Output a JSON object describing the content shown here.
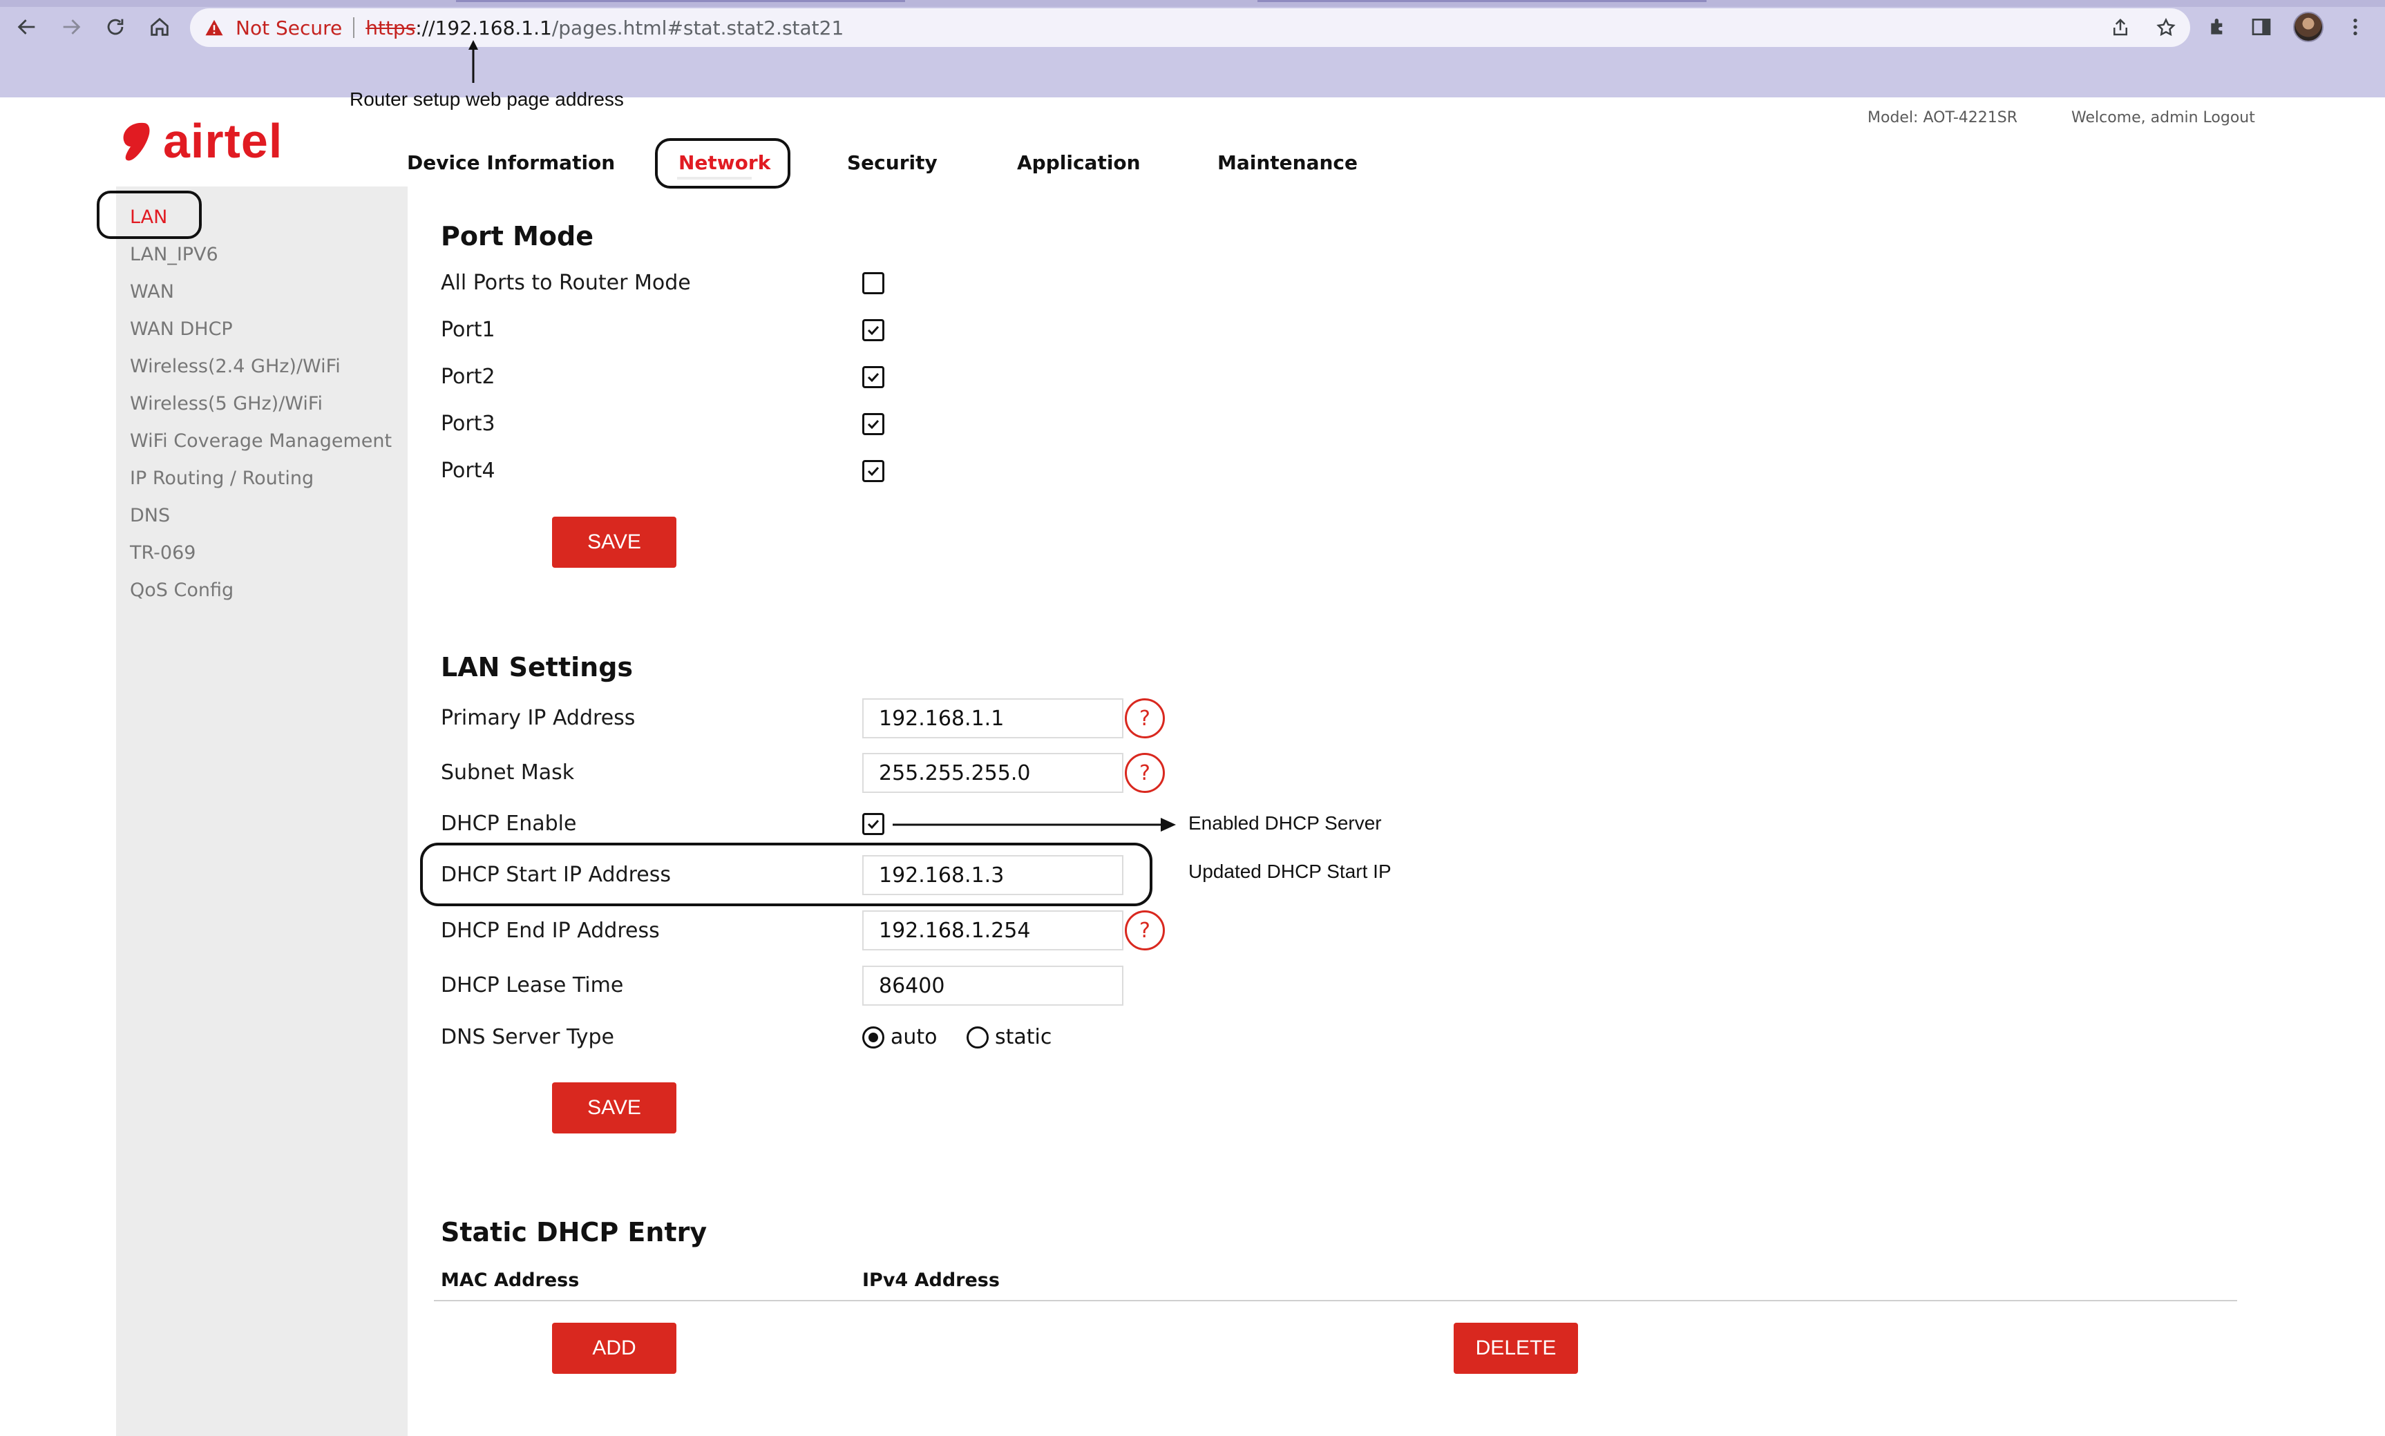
{
  "browser": {
    "security_label": "Not Secure",
    "url_scheme": "https",
    "url_host": "://192.168.1.1",
    "url_path": "/pages.html#stat.stat2.stat21"
  },
  "annotations": {
    "address_note": "Router setup web page address",
    "dhcp_enable_note": "Enabled DHCP Server",
    "dhcp_start_note": "Updated DHCP Start IP"
  },
  "header": {
    "logo_text": "airtel",
    "model": "Model: AOT-4221SR",
    "welcome": "Welcome, admin Logout",
    "nav": [
      "Device Information",
      "Network",
      "Security",
      "Application",
      "Maintenance"
    ],
    "active_nav": "Network"
  },
  "sidebar": {
    "items": [
      "LAN",
      "LAN_IPV6",
      "WAN",
      "WAN DHCP",
      "Wireless(2.4 GHz)/WiFi",
      "Wireless(5 GHz)/WiFi",
      "WiFi Coverage Management",
      "IP Routing / Routing",
      "DNS",
      "TR-069",
      "QoS Config"
    ],
    "active_item": "LAN"
  },
  "port_mode": {
    "title": "Port Mode",
    "rows": [
      {
        "label": "All Ports to Router Mode",
        "checked": false
      },
      {
        "label": "Port1",
        "checked": true
      },
      {
        "label": "Port2",
        "checked": true
      },
      {
        "label": "Port3",
        "checked": true
      },
      {
        "label": "Port4",
        "checked": true
      }
    ],
    "save_label": "SAVE"
  },
  "lan_settings": {
    "title": "LAN Settings",
    "primary_ip": {
      "label": "Primary IP Address",
      "value": "192.168.1.1"
    },
    "subnet_mask": {
      "label": "Subnet Mask",
      "value": "255.255.255.0"
    },
    "dhcp_enable": {
      "label": "DHCP Enable",
      "checked": true
    },
    "dhcp_start": {
      "label": "DHCP Start IP Address",
      "value": "192.168.1.3"
    },
    "dhcp_end": {
      "label": "DHCP End IP Address",
      "value": "192.168.1.254"
    },
    "dhcp_lease": {
      "label": "DHCP Lease Time",
      "value": "86400"
    },
    "dns_type": {
      "label": "DNS Server Type",
      "options": [
        "auto",
        "static"
      ],
      "selected": "auto"
    },
    "help_symbol": "?",
    "save_label": "SAVE"
  },
  "static_dhcp": {
    "title": "Static DHCP Entry",
    "columns": [
      "MAC Address",
      "IPv4 Address"
    ],
    "add_label": "ADD",
    "delete_label": "DELETE"
  },
  "colors": {
    "brand_red": "#e11b22",
    "button_red": "#d9281f",
    "chrome_bg": "#cac8e6",
    "sidebar_bg": "#ececec"
  }
}
